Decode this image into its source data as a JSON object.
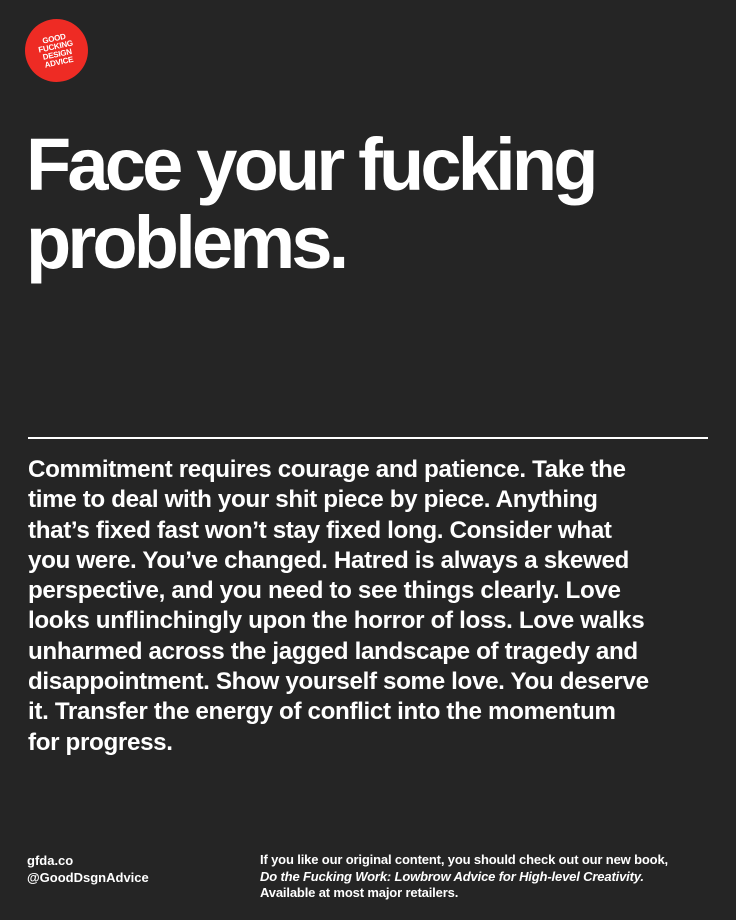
{
  "badge": {
    "lines": [
      "GOOD",
      "FUCKING",
      "DESIGN",
      "ADVICE"
    ],
    "color": "#ee2b24"
  },
  "headline": {
    "lines": [
      "Face your fucking",
      "problems."
    ]
  },
  "body": {
    "lines": [
      "Commitment requires courage and patience. Take the",
      "time to deal with your shit piece by piece. Anything",
      "that’s fixed fast won’t stay fixed long. Consider what",
      "you were. You’ve changed. Hatred is always a skewed",
      "perspective, and you need to see things clearly. Love",
      "looks unflinchingly upon the horror of loss. Love walks",
      "unharmed across the jagged landscape of tragedy and",
      "disappointment. Show yourself some love. You deserve",
      "it. Transfer the energy of conflict into the momentum",
      "for progress."
    ]
  },
  "footer": {
    "website": "gfda.co",
    "handle": "@GoodDsgnAdvice",
    "promo_line1": "If you like our original content, you should check out our new book,",
    "promo_book_title": "Do the Fucking Work: Lowbrow Advice for High-level Creativity.",
    "promo_line3": "Available at most major retailers."
  },
  "colors": {
    "background": "#252525",
    "text": "#ffffff",
    "accent": "#ee2b24"
  }
}
